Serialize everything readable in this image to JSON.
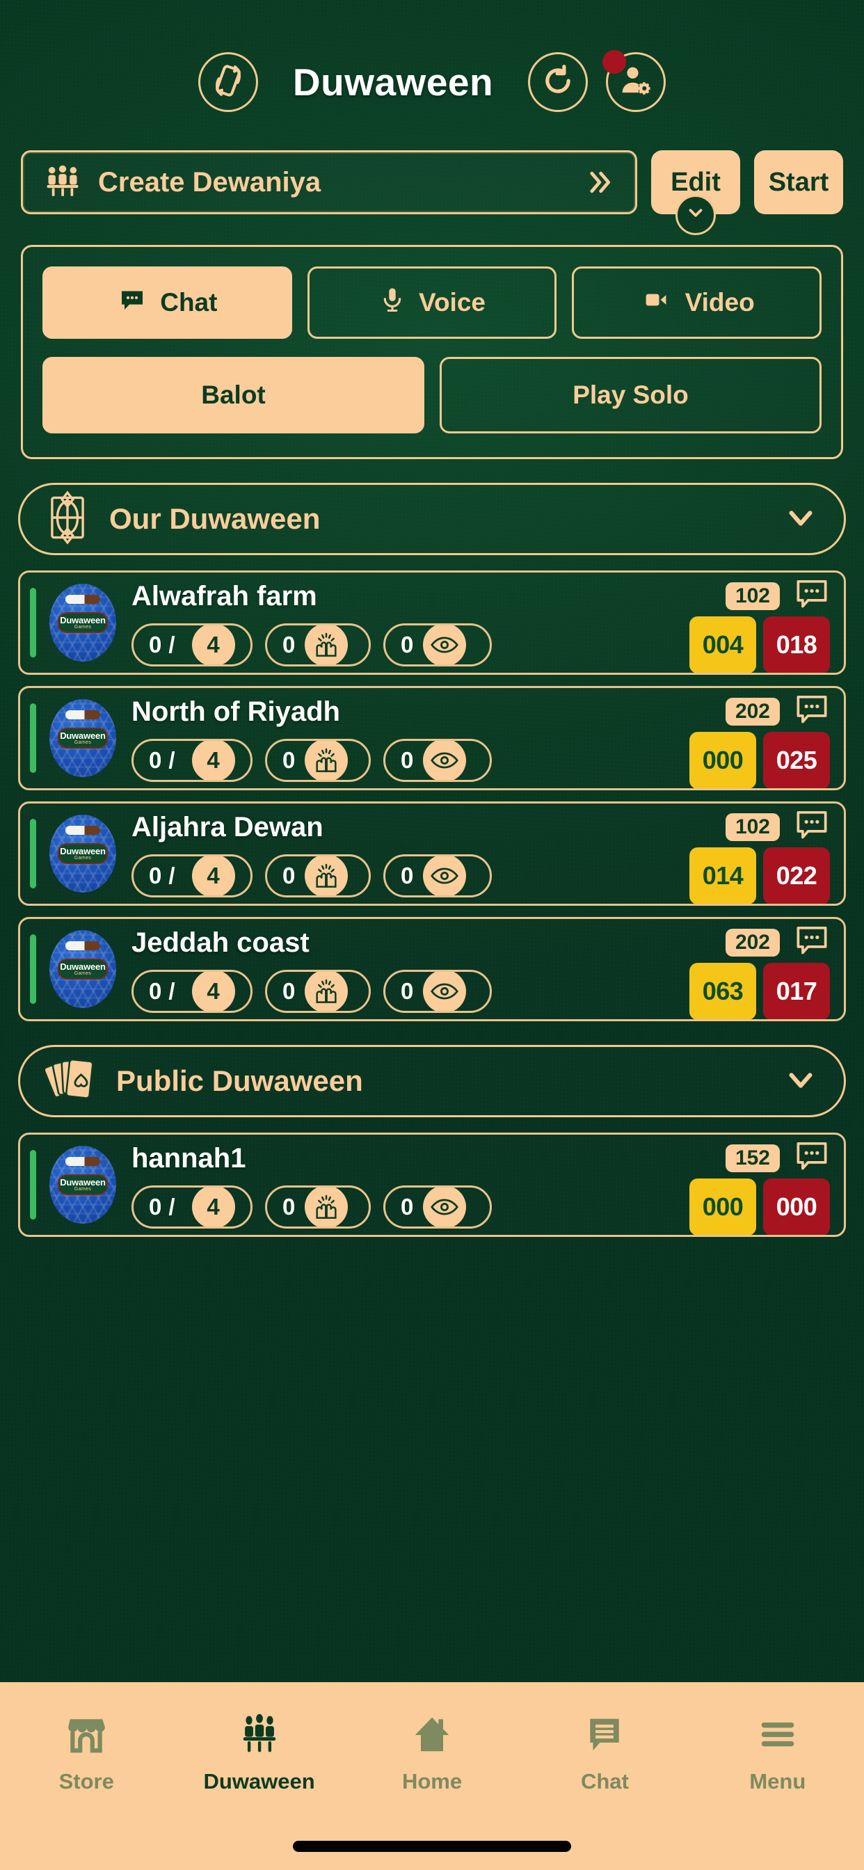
{
  "header": {
    "title": "Duwaween",
    "left_icon": "rotate-device-icon",
    "refresh_icon": "refresh-icon",
    "profile_icon": "profile-settings-icon",
    "notification_badge": true
  },
  "actions": {
    "create_label": "Create Dewaniya",
    "create_icon": "group-table-icon",
    "create_chevron_icon": "chevron-double-right-icon",
    "edit_label": "Edit",
    "edit_caret_icon": "chevron-down-icon",
    "start_label": "Start"
  },
  "modes": {
    "row1": [
      {
        "label": "Chat",
        "icon": "chat-bubble-icon",
        "active": true
      },
      {
        "label": "Voice",
        "icon": "microphone-icon",
        "active": false
      },
      {
        "label": "Video",
        "icon": "video-camera-icon",
        "active": false
      }
    ],
    "row2": [
      {
        "label": "Balot",
        "icon": "",
        "active": true
      },
      {
        "label": "Play Solo",
        "icon": "",
        "active": false
      }
    ]
  },
  "sections": [
    {
      "title": "Our Duwaween",
      "icon": "ornament-icon",
      "caret_icon": "chevron-down-icon",
      "rooms": [
        {
          "name": "Alwafrah farm",
          "code": "102",
          "players": "0",
          "capacity": "4",
          "spectators": "0",
          "views": "0",
          "score_yellow": "004",
          "score_red": "018"
        },
        {
          "name": "North of Riyadh",
          "code": "202",
          "players": "0",
          "capacity": "4",
          "spectators": "0",
          "views": "0",
          "score_yellow": "000",
          "score_red": "025"
        },
        {
          "name": "Aljahra Dewan",
          "code": "102",
          "players": "0",
          "capacity": "4",
          "spectators": "0",
          "views": "0",
          "score_yellow": "014",
          "score_red": "022"
        },
        {
          "name": "Jeddah coast",
          "code": "202",
          "players": "0",
          "capacity": "4",
          "spectators": "0",
          "views": "0",
          "score_yellow": "063",
          "score_red": "017"
        }
      ]
    },
    {
      "title": "Public Duwaween",
      "icon": "playing-cards-icon",
      "caret_icon": "chevron-down-icon",
      "rooms": [
        {
          "name": "hannah1",
          "code": "152",
          "players": "0",
          "capacity": "4",
          "spectators": "0",
          "views": "0",
          "score_yellow": "000",
          "score_red": "000"
        }
      ]
    }
  ],
  "room_icons": {
    "chat_icon": "chat-bubble-icon",
    "players_icon": "players-icon",
    "spectators_icon": "celebrate-hands-icon",
    "views_icon": "eye-icon",
    "avatar_badge_line1": "Duwaween",
    "avatar_badge_line2": "Games"
  },
  "tabbar": [
    {
      "label": "Store",
      "icon": "store-icon",
      "active": false
    },
    {
      "label": "Duwaween",
      "icon": "duwaween-icon",
      "active": true
    },
    {
      "label": "Home",
      "icon": "home-icon",
      "active": false
    },
    {
      "label": "Chat",
      "icon": "chat-icon",
      "active": false
    },
    {
      "label": "Menu",
      "icon": "menu-icon",
      "active": false
    }
  ],
  "colors": {
    "bg_green": "#0b3d24",
    "accent_cream": "#fbcd9a",
    "score_yellow": "#f5c518",
    "score_red": "#a71420",
    "status_green": "#3dbb63",
    "notif_red": "#a71420"
  }
}
